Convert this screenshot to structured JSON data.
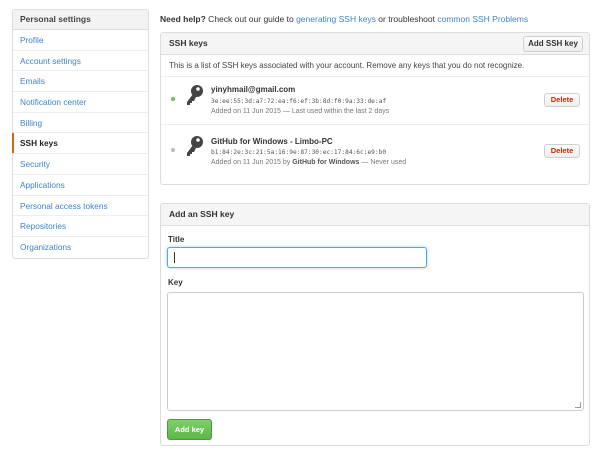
{
  "sidebar": {
    "header": "Personal settings",
    "items": [
      {
        "label": "Profile"
      },
      {
        "label": "Account settings"
      },
      {
        "label": "Emails"
      },
      {
        "label": "Notification center"
      },
      {
        "label": "Billing"
      },
      {
        "label": "SSH keys",
        "selected": true
      },
      {
        "label": "Security"
      },
      {
        "label": "Applications"
      },
      {
        "label": "Personal access tokens"
      },
      {
        "label": "Repositories"
      },
      {
        "label": "Organizations"
      }
    ]
  },
  "help": {
    "prefix": "Need help?",
    "text1": " Check out our guide to ",
    "link1": "generating SSH keys",
    "text2": " or troubleshoot ",
    "link2": "common SSH Problems"
  },
  "ssh_keys": {
    "title": "SSH keys",
    "add_button": "Add SSH key",
    "intro": "This is a list of SSH keys associated with your account. Remove any keys that you do not recognize.",
    "keys": [
      {
        "title": "yinyhmail@gmail.com",
        "fingerprint": "3e:ee:55:3d:a7:72:ea:f6:ef:3b:8d:f0:9a:33:de:af",
        "added": "Added on 11 Jun 2015 — Last used within the last 2 days",
        "by": "",
        "after_by": "",
        "delete_label": "Delete",
        "status_color": "#6cc644"
      },
      {
        "title": "GitHub for Windows - Limbo-PC",
        "fingerprint": "b1:84:2e:3c:21:5a:16:9e:87:30:ec:17:84:6c:e9:b0",
        "added": "Added on 11 Jun 2015 by ",
        "by": "GitHub for Windows",
        "after_by": " — Never used",
        "delete_label": "Delete",
        "status_color": "#bbbbbb"
      }
    ]
  },
  "add_key": {
    "title": "Add an SSH key",
    "title_label": "Title",
    "title_value": "",
    "key_label": "Key",
    "key_value": "",
    "submit_label": "Add key"
  },
  "colors": {
    "link": "#4183c4",
    "selected_accent": "#d26911",
    "danger": "#bd2c00",
    "primary": "#5db746"
  }
}
